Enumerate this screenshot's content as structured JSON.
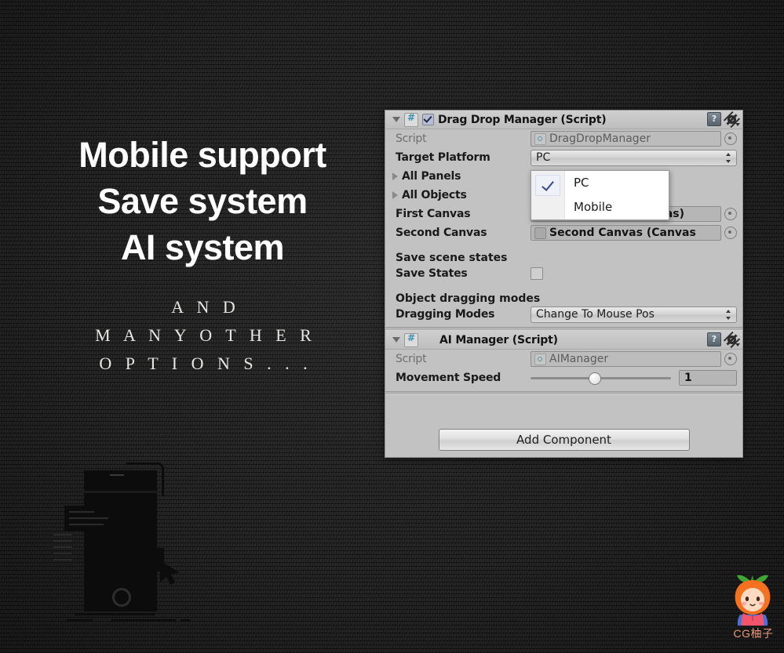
{
  "promo": {
    "headline_lines": [
      "Mobile support",
      "Save system",
      "AI system"
    ],
    "subcopy_lines": [
      "A N D",
      "M A N Y   O T H E R",
      "O P T I O N S . . ."
    ],
    "background_color": "#1c1c1c",
    "headline_color": "#ffffff"
  },
  "watermark": {
    "label": "CG柚子",
    "label_color": "#e4997a",
    "mascot": "orange-hooded-character"
  },
  "inspector": {
    "background_color": "#c2c2c2",
    "components": [
      {
        "id": "drag-drop-manager",
        "title": "Drag Drop Manager (Script)",
        "enabled": true,
        "foldout": "expanded",
        "help_icon": "help-book-icon",
        "gear_icon": "gear-icon",
        "script_icon": "cs-script-icon",
        "rows": [
          {
            "type": "object",
            "label": "Script",
            "label_dim": true,
            "value": "DragDropManager",
            "icon": "cs-script-icon",
            "disabled": true,
            "target_picker": true
          },
          {
            "type": "popup",
            "label": "Target Platform",
            "value": "PC"
          },
          {
            "type": "foldout",
            "label": "All Panels",
            "state": "collapsed"
          },
          {
            "type": "foldout",
            "label": "All Objects",
            "state": "collapsed"
          },
          {
            "type": "object",
            "label": "First Canvas",
            "value": "First Canvas (Canvas)",
            "value_bold": true,
            "icon": "canvas-icon",
            "target_picker": true
          },
          {
            "type": "object",
            "label": "Second Canvas",
            "value": "Second Canvas (Canvas",
            "value_bold": true,
            "icon": "canvas-icon",
            "target_picker": true
          },
          {
            "type": "spacer"
          },
          {
            "type": "header",
            "label": "Save scene states"
          },
          {
            "type": "checkbox",
            "label": "Save States",
            "checked": false
          },
          {
            "type": "spacer"
          },
          {
            "type": "header",
            "label": "Object dragging modes"
          },
          {
            "type": "popup",
            "label": "Dragging Modes",
            "value": "Change To Mouse Pos"
          }
        ]
      },
      {
        "id": "ai-manager",
        "title": "AI Manager (Script)",
        "enabled": null,
        "foldout": "expanded",
        "help_icon": "help-book-icon",
        "gear_icon": "gear-icon",
        "script_icon": "cs-script-icon",
        "rows": [
          {
            "type": "object",
            "label": "Script",
            "label_dim": true,
            "value": "AIManager",
            "icon": "cs-script-icon",
            "disabled": true,
            "target_picker": true
          },
          {
            "type": "slider",
            "label": "Movement Speed",
            "value": "1",
            "knob_percent": 45
          }
        ]
      }
    ],
    "add_component_label": "Add Component",
    "dropdown": {
      "open": true,
      "selected": "PC",
      "options": [
        "PC",
        "Mobile"
      ],
      "check_icon": "checkmark-icon"
    }
  }
}
